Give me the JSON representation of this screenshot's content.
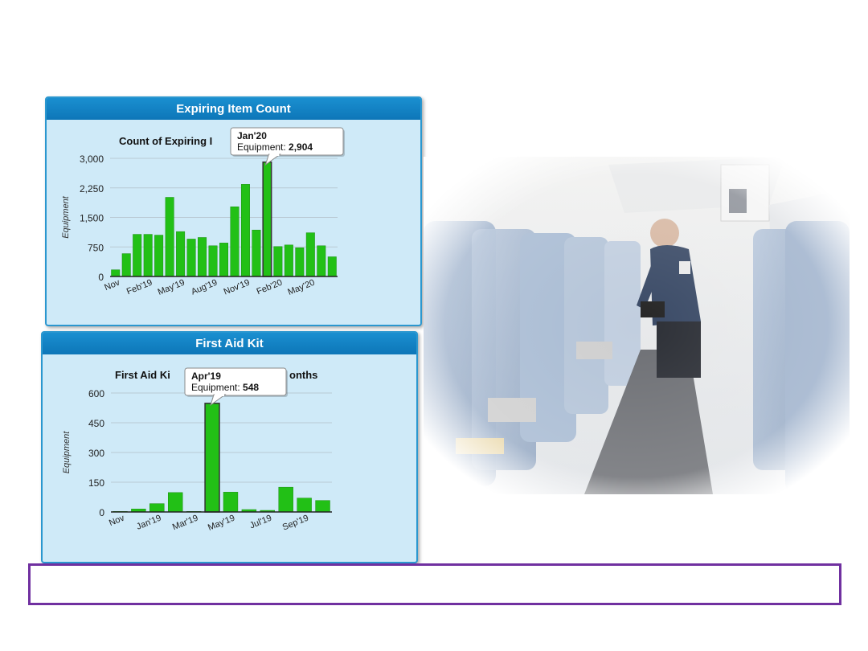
{
  "charts": [
    {
      "panel_title": "Expiring Item Count",
      "subtitle": "Count of Expiring I",
      "tooltip": {
        "label": "Jan'20",
        "series": "Equipment:",
        "value": "2,904"
      }
    },
    {
      "panel_title": "First Aid Kit",
      "subtitle_left": "First Aid Ki",
      "subtitle_right": "onths",
      "tooltip": {
        "label": "Apr'19",
        "series": "Equipment:",
        "value": "548"
      }
    }
  ],
  "colors": {
    "bar": "#22c016",
    "bar_stroke": "#1a8f10",
    "header": "#1282c5",
    "panel_bg": "#cfeaf8",
    "frame": "#7030a0"
  },
  "chart_data": [
    {
      "type": "bar",
      "title": "Count of Expiring I",
      "ylabel": "Equipment",
      "ylim": [
        0,
        3000
      ],
      "yticks": [
        0,
        750,
        1500,
        2250,
        3000
      ],
      "ytick_labels": [
        "0",
        "750",
        "1,500",
        "2,250",
        "3,000"
      ],
      "x_tick_labels": [
        "Nov",
        "Feb'19",
        "May'19",
        "Aug'19",
        "Nov'19",
        "Feb'20",
        "May'20"
      ],
      "x_tick_positions": [
        0,
        3,
        6,
        9,
        12,
        15,
        18
      ],
      "categories": [
        "Nov'18",
        "Dec'18",
        "Jan'19",
        "Feb'19",
        "Mar'19",
        "Apr'19",
        "May'19",
        "Jun'19",
        "Jul'19",
        "Aug'19",
        "Sep'19",
        "Oct'19",
        "Nov'19",
        "Dec'19",
        "Jan'20",
        "Feb'20",
        "Mar'20",
        "Apr'20",
        "May'20",
        "Jun'20",
        "Jul'20"
      ],
      "values": [
        170,
        580,
        1070,
        1070,
        1050,
        2010,
        1140,
        950,
        990,
        780,
        850,
        1770,
        2340,
        1180,
        2904,
        760,
        800,
        730,
        1110,
        780,
        500
      ],
      "highlight_index": 14,
      "grid": true
    },
    {
      "type": "bar",
      "title": "First Aid Ki... onths",
      "ylabel": "Equipment",
      "ylim": [
        0,
        600
      ],
      "yticks": [
        0,
        150,
        300,
        450,
        600
      ],
      "ytick_labels": [
        "0",
        "150",
        "300",
        "450",
        "600"
      ],
      "x_tick_labels": [
        "Nov",
        "Jan'19",
        "Mar'19",
        "May'19",
        "Jul'19",
        "Sep'19"
      ],
      "x_tick_positions": [
        0,
        2,
        4,
        6,
        8,
        10
      ],
      "categories": [
        "Nov'18",
        "Dec'18",
        "Jan'19",
        "Feb'19",
        "Mar'19",
        "Apr'19",
        "May'19",
        "Jun'19",
        "Jul'19",
        "Aug'19",
        "Sep'19",
        "Oct'19"
      ],
      "values": [
        3,
        15,
        42,
        98,
        3,
        548,
        100,
        12,
        8,
        125,
        70,
        58
      ],
      "highlight_index": 5,
      "grid": true
    }
  ]
}
